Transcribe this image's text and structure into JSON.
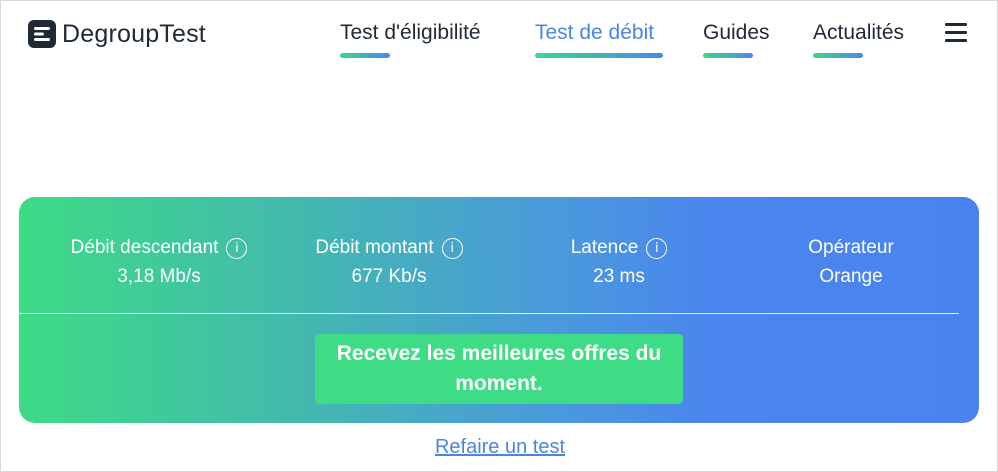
{
  "brand": {
    "name": "DegroupTest",
    "logo_icon": "degrouptest-logo-icon"
  },
  "nav": {
    "items": [
      {
        "label": "Test d'éligibilité",
        "active": false
      },
      {
        "label": "Test de débit",
        "active": true
      },
      {
        "label": "Guides",
        "active": false
      },
      {
        "label": "Actualités",
        "active": false
      }
    ],
    "menu_icon": "hamburger-menu-icon"
  },
  "results": {
    "download": {
      "label": "Débit descendant",
      "value": "3,18 Mb/s",
      "info_icon": "i"
    },
    "upload": {
      "label": "Débit montant",
      "value": "677 Kb/s",
      "info_icon": "i"
    },
    "latency": {
      "label": "Latence",
      "value": "23 ms",
      "info_icon": "i"
    },
    "operator": {
      "label": "Opérateur",
      "value": "Orange"
    }
  },
  "cta": {
    "label": "Recevez les meilleures offres du moment."
  },
  "retest": {
    "label": "Refaire un test"
  },
  "colors": {
    "gradient_start": "#3ddb85",
    "gradient_end": "#4a83f0",
    "accent": "#4a86e0",
    "text": "#1f2a36"
  }
}
